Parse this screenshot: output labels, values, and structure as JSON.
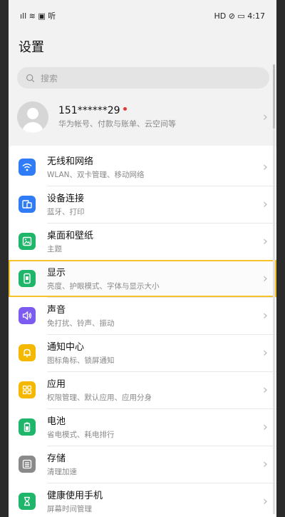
{
  "status_bar": {
    "left": "ıll ≋ ▣ 听",
    "right": "HD ⊘ ▭ 4:17"
  },
  "page_title": "设置",
  "search": {
    "placeholder": "搜索"
  },
  "account": {
    "name": "151******29",
    "subtitle": "华为帐号、付款与账单、云空间等"
  },
  "settings_items": [
    {
      "label": "无线和网络",
      "sub": "WLAN、双卡管理、移动网络",
      "icon": "wifi-icon",
      "color": "#2f7cf6"
    },
    {
      "label": "设备连接",
      "sub": "蓝牙、打印",
      "icon": "device-connect-icon",
      "color": "#2f7cf6"
    },
    {
      "label": "桌面和壁纸",
      "sub": "主题",
      "icon": "wallpaper-icon",
      "color": "#1fb56b"
    },
    {
      "label": "显示",
      "sub": "亮度、护眼模式、字体与显示大小",
      "icon": "display-icon",
      "color": "#1fb56b"
    },
    {
      "label": "声音",
      "sub": "免打扰、铃声、振动",
      "icon": "sound-icon",
      "color": "#7c5cf0"
    },
    {
      "label": "通知中心",
      "sub": "图标角标、锁屏通知",
      "icon": "notification-icon",
      "color": "#f5b800"
    },
    {
      "label": "应用",
      "sub": "权限管理、默认应用、应用分身",
      "icon": "apps-icon",
      "color": "#f5b800"
    },
    {
      "label": "电池",
      "sub": "省电模式、耗电排行",
      "icon": "battery-icon",
      "color": "#1fb56b"
    },
    {
      "label": "存储",
      "sub": "清理加速",
      "icon": "storage-icon",
      "color": "#8a8a8a"
    },
    {
      "label": "健康使用手机",
      "sub": "屏幕时间管理",
      "icon": "hourglass-icon",
      "color": "#1fb56b"
    }
  ],
  "highlight_color": "#f6c22a"
}
